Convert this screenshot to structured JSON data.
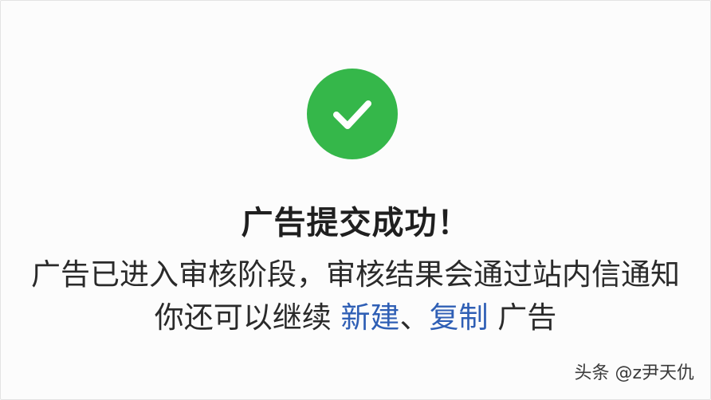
{
  "status": {
    "icon": "check-circle-icon",
    "color": "#35b74a",
    "title": "广告提交成功！"
  },
  "message": {
    "line1": "广告已进入审核阶段，审核结果会通过站内信通知",
    "line2_prefix": "你还可以继续",
    "link_new": "新建",
    "separator": "、",
    "link_copy": "复制",
    "line2_suffix": "广告",
    "link_color": "#2f5fb5"
  },
  "watermark": {
    "text": "头条 @z尹天仇"
  }
}
